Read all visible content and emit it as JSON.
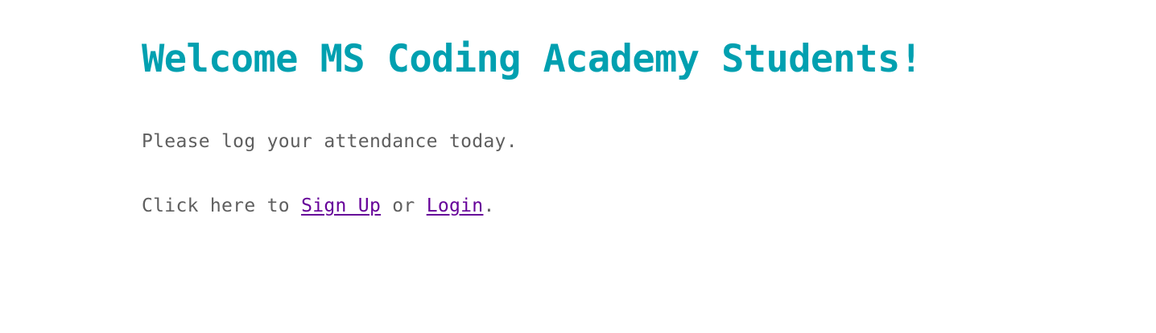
{
  "welcome": {
    "title": "Welcome MS Coding Academy Students!"
  },
  "attendance": {
    "message": "Please log your attendance today."
  },
  "actions": {
    "prefix": "Click here to ",
    "signup_label": "Sign Up",
    "separator": " or ",
    "login_label": "Login",
    "suffix": "."
  },
  "colors": {
    "title": "#00a0b0",
    "text": "#5f5f5f",
    "link_visited": "#660099",
    "background": "#ffffff"
  }
}
